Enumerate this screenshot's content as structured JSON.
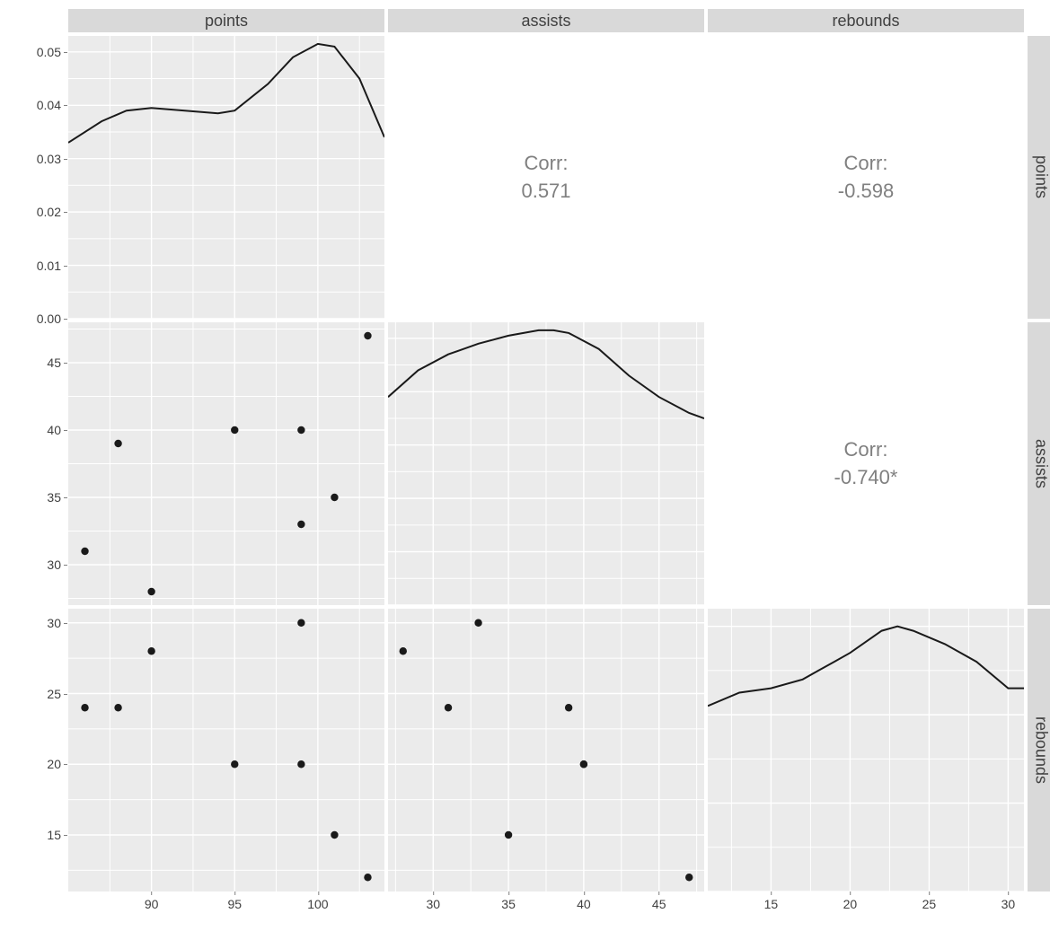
{
  "variables": [
    "points",
    "assists",
    "rebounds"
  ],
  "chart_data": {
    "type": "pairs",
    "variables": [
      "points",
      "assists",
      "rebounds"
    ],
    "observations": [
      {
        "points": 86,
        "assists": 31,
        "rebounds": 24
      },
      {
        "points": 88,
        "assists": 39,
        "rebounds": 24
      },
      {
        "points": 90,
        "assists": 28,
        "rebounds": 28
      },
      {
        "points": 95,
        "assists": 40,
        "rebounds": 20
      },
      {
        "points": 99,
        "assists": 33,
        "rebounds": 30
      },
      {
        "points": 99,
        "assists": 40,
        "rebounds": 20
      },
      {
        "points": 101,
        "assists": 35,
        "rebounds": 15
      },
      {
        "points": 103,
        "assists": 47,
        "rebounds": 12
      }
    ],
    "correlations": {
      "points_assists": {
        "label": "Corr:",
        "value": "0.571"
      },
      "points_rebounds": {
        "label": "Corr:",
        "value": "-0.598"
      },
      "assists_rebounds": {
        "label": "Corr:",
        "value": "-0.740*"
      }
    },
    "panel_scales": {
      "points": {
        "lim": [
          85,
          104
        ],
        "ticks": [
          90,
          95,
          100
        ]
      },
      "assists": {
        "lim": [
          27,
          48
        ],
        "ticks": [
          30,
          35,
          40,
          45
        ]
      },
      "rebounds": {
        "lim": [
          11,
          31
        ],
        "ticks": [
          15,
          20,
          25,
          30
        ]
      }
    },
    "diag_density": {
      "points": {
        "ylim": [
          0.0,
          0.053
        ],
        "yticks": [
          0.0,
          0.01,
          0.02,
          0.03,
          0.04,
          0.05
        ],
        "points": [
          [
            85,
            0.033
          ],
          [
            87,
            0.037
          ],
          [
            88.5,
            0.039
          ],
          [
            90,
            0.0395
          ],
          [
            92,
            0.039
          ],
          [
            94,
            0.0385
          ],
          [
            95,
            0.039
          ],
          [
            97,
            0.044
          ],
          [
            98.5,
            0.049
          ],
          [
            100,
            0.0515
          ],
          [
            101,
            0.051
          ],
          [
            102.5,
            0.045
          ],
          [
            104,
            0.034
          ]
        ]
      },
      "assists": {
        "points": [
          [
            27,
            0.039
          ],
          [
            29,
            0.044
          ],
          [
            31,
            0.047
          ],
          [
            33,
            0.049
          ],
          [
            35,
            0.0505
          ],
          [
            37,
            0.0515
          ],
          [
            38,
            0.0515
          ],
          [
            39,
            0.051
          ],
          [
            41,
            0.048
          ],
          [
            43,
            0.043
          ],
          [
            45,
            0.039
          ],
          [
            47,
            0.036
          ],
          [
            48,
            0.035
          ]
        ],
        "remap_to_points_ylim": true
      },
      "rebounds": {
        "points": [
          [
            11,
            0.021
          ],
          [
            13,
            0.0225
          ],
          [
            15,
            0.023
          ],
          [
            17,
            0.024
          ],
          [
            18,
            0.025
          ],
          [
            19,
            0.026
          ],
          [
            20,
            0.027
          ],
          [
            22,
            0.0295
          ],
          [
            23,
            0.03
          ],
          [
            24,
            0.0295
          ],
          [
            26,
            0.028
          ],
          [
            28,
            0.026
          ],
          [
            30,
            0.023
          ],
          [
            31,
            0.023
          ]
        ],
        "remap_to_points_ylim": true
      }
    }
  }
}
